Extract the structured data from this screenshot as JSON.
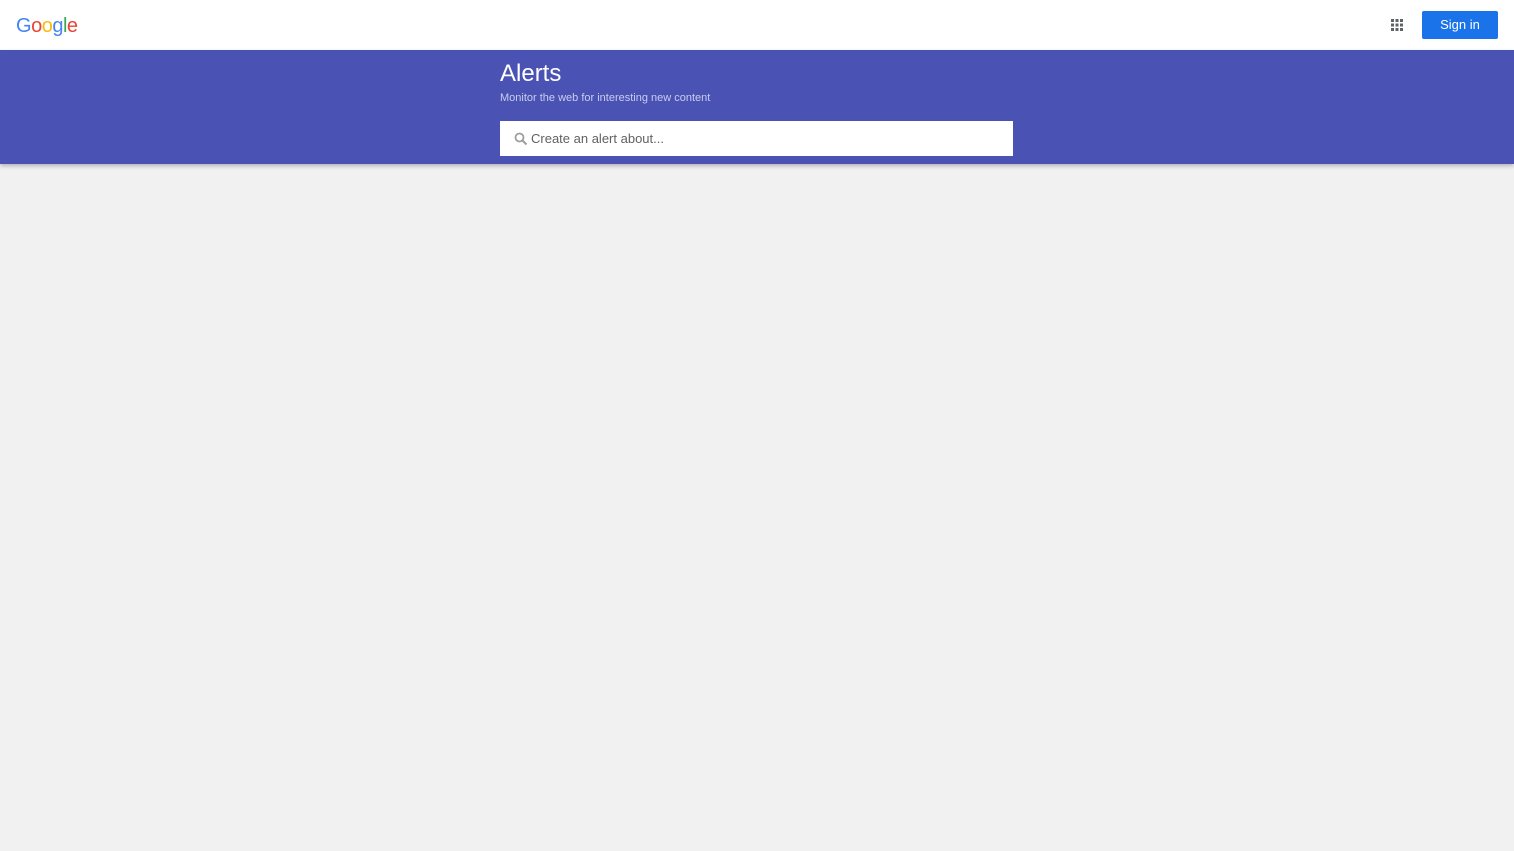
{
  "header": {
    "logo": [
      "G",
      "o",
      "o",
      "g",
      "l",
      "e"
    ],
    "apps_icon": "grid-apps-icon",
    "signin_label": "Sign in"
  },
  "banner": {
    "title": "Alerts",
    "subtitle": "Monitor the web for interesting new content"
  },
  "search": {
    "placeholder": "Create an alert about...",
    "value": "",
    "icon": "search-icon"
  },
  "colors": {
    "banner": "#4a53b3",
    "signin": "#1a73e8",
    "background": "#f1f1f1"
  }
}
